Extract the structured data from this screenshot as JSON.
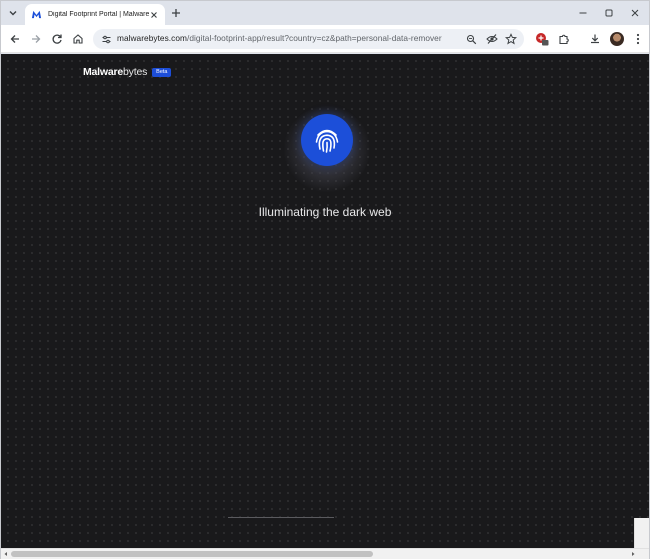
{
  "browser": {
    "tab": {
      "title": "Digital Footprint Portal | Malwarebytes",
      "favicon": "malwarebytes-icon"
    },
    "address_bar": {
      "host": "malwarebytes.com",
      "path": "/digital-footprint-app/result?country=cz&path=personal-data-remover"
    },
    "icons": {
      "tab_search": "chevron-down-icon",
      "tab_close": "close-icon",
      "new_tab": "plus-icon",
      "minimize": "minimize-icon",
      "maximize": "maximize-icon",
      "close_window": "close-icon",
      "back": "back-arrow-icon",
      "forward": "forward-arrow-icon",
      "reload": "reload-icon",
      "home": "home-icon",
      "site_info": "tune-icon",
      "zoom": "zoom-icon",
      "tracking": "eye-off-icon",
      "bookmark": "star-icon",
      "extension": "extension-badge-icon",
      "extensions": "puzzle-icon",
      "downloads": "download-icon",
      "menu": "kebab-menu-icon"
    }
  },
  "page": {
    "brand": {
      "name_bold": "Malware",
      "name_light": "bytes",
      "badge": "Beta"
    },
    "status": "Illuminating the dark web"
  },
  "colors": {
    "page_bg": "#19191b",
    "accent": "#1c4fd9",
    "chrome_bg": "#dfe3eb"
  }
}
